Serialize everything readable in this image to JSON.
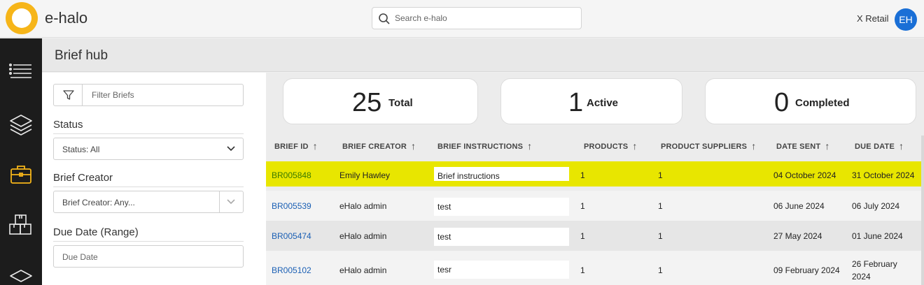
{
  "header": {
    "brand": "e-halo",
    "search_placeholder": "Search e-halo",
    "account_name": "X Retail",
    "avatar_initials": "EH"
  },
  "page": {
    "title": "Brief hub"
  },
  "filters": {
    "filter_placeholder": "Filter Briefs",
    "status_label": "Status",
    "status_value": "Status: All",
    "creator_label": "Brief Creator",
    "creator_value": "Brief Creator: Any...",
    "due_label": "Due Date (Range)",
    "due_placeholder": "Due Date"
  },
  "stats": [
    {
      "value": "25",
      "label": "Total"
    },
    {
      "value": "1",
      "label": "Active"
    },
    {
      "value": "0",
      "label": "Completed"
    }
  ],
  "table": {
    "columns": [
      "BRIEF ID",
      "BRIEF CREATOR",
      "BRIEF INSTRUCTIONS",
      "PRODUCTS",
      "PRODUCT SUPPLIERS",
      "DATE SENT",
      "DUE DATE"
    ],
    "rows": [
      {
        "id": "BR005848",
        "creator": "Emily Hawley",
        "instructions": "Brief instructions",
        "products": "1",
        "suppliers": "1",
        "date_sent": "04 October 2024",
        "due_date": "31 October 2024",
        "due_date_2": ""
      },
      {
        "id": "BR005539",
        "creator": "eHalo admin",
        "instructions": "test",
        "products": "1",
        "suppliers": "1",
        "date_sent": "06 June 2024",
        "due_date": "06 July 2024",
        "due_date_2": ""
      },
      {
        "id": "BR005474",
        "creator": "eHalo admin",
        "instructions": "test",
        "products": "1",
        "suppliers": "1",
        "date_sent": "27 May 2024",
        "due_date": "01 June 2024",
        "due_date_2": ""
      },
      {
        "id": "BR005102",
        "creator": "eHalo admin",
        "instructions": "tesr",
        "products": "1",
        "suppliers": "1",
        "date_sent": "09 February 2024",
        "due_date": "26 February",
        "due_date_2": "2024"
      }
    ]
  },
  "colors": {
    "accent_yellow": "#f6b519",
    "highlight_row": "#e8e600",
    "avatar_blue": "#1a6fd6",
    "link_blue": "#1a5fb4",
    "rail_bg": "#1c1c1c"
  },
  "icons": {
    "rail": [
      "list-menu-icon",
      "layers-icon",
      "briefcase-icon",
      "boxes-icon",
      "diamond-layer-icon"
    ],
    "search": "search-icon",
    "filter": "funnel-icon",
    "sort": "arrow-up-icon",
    "dropdown": "chevron-down-icon"
  }
}
